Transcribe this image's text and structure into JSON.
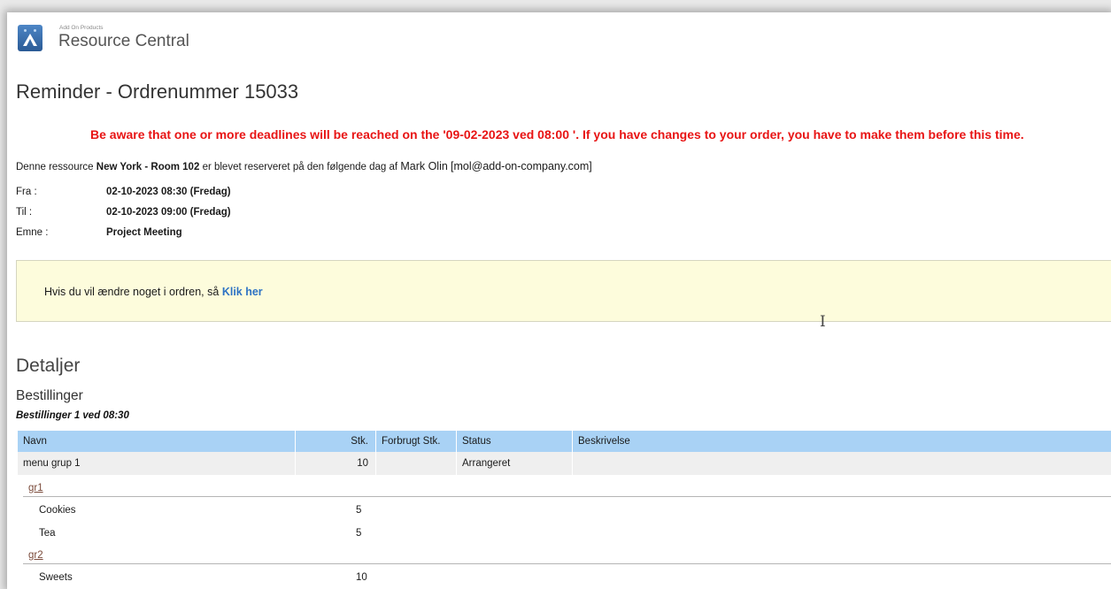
{
  "header": {
    "brand_small": "Add On Products",
    "brand_name": "Resource Central"
  },
  "title": "Reminder - Ordrenummer 15033",
  "warning": "Be aware that one or more deadlines will be reached on the '09-02-2023 ved 08:00 '. If you have changes to your order, you have to make them before this time.",
  "reservation": {
    "prefix": "Denne ressource",
    "resource": "New York",
    "sep": "-",
    "room": "Room 102",
    "middle": "er blevet reserveret på den følgende dag af",
    "person": "Mark Olin",
    "email": "[mol@add-on-company.com]"
  },
  "fields": [
    {
      "label": "Fra :",
      "value": "02-10-2023 08:30 (Fredag)"
    },
    {
      "label": "Til :",
      "value": "02-10-2023 09:00 (Fredag)"
    },
    {
      "label": "Emne :",
      "value": "Project Meeting"
    }
  ],
  "notice": {
    "text": "Hvis du vil ændre noget i ordren, så",
    "link": "Klik her",
    "background": "#fdfcdc"
  },
  "details": {
    "heading": "Detaljer",
    "subheading": "Bestillinger",
    "batch_title": "Bestillinger 1 ved 08:30",
    "columns": [
      "Navn",
      "Stk.",
      "Forbrugt Stk.",
      "Status",
      "Beskrivelse"
    ],
    "main_row": {
      "name": "menu grup 1",
      "qty": "10",
      "used": "",
      "status": "Arrangeret",
      "description": ""
    },
    "groups": [
      {
        "name": "gr1",
        "items": [
          {
            "name": "Cookies",
            "qty": "5"
          },
          {
            "name": "Tea",
            "qty": "5"
          }
        ]
      },
      {
        "name": "gr2",
        "items": [
          {
            "name": "Sweets",
            "qty": "10"
          }
        ]
      }
    ]
  },
  "colors": {
    "warning": "#e81414",
    "table_header": "#a9d2f5",
    "link": "#2e73c4"
  },
  "icons": {
    "logo": "add-on-logo-icon",
    "cursor": "text-cursor-icon"
  }
}
